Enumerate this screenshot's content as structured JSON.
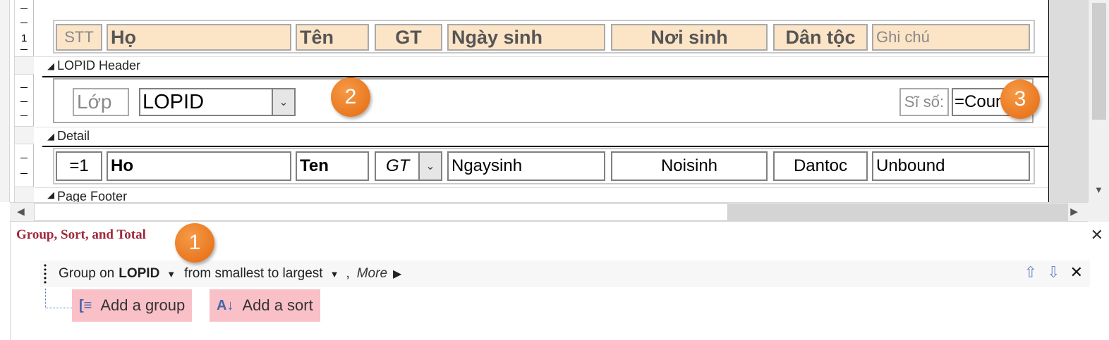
{
  "ruler": {
    "number": "1"
  },
  "page_header": {
    "labels": [
      "STT",
      "Họ",
      "Tên",
      "GT",
      "Ngày sinh",
      "Nơi sinh",
      "Dân tộc",
      "Ghi  chú"
    ]
  },
  "lopid_header": {
    "section_label": "LOPID Header",
    "label_lop": "Lớp",
    "combo_value": "LOPID",
    "label_siso": "Sĩ số:",
    "count_value": "=Coun"
  },
  "detail": {
    "section_label": "Detail",
    "fields": [
      "=1",
      "Ho",
      "Ten",
      "GT",
      "Ngaysinh",
      "Noisinh",
      "Dantoc",
      "Unbound"
    ]
  },
  "page_footer": {
    "section_label": "Page Footer"
  },
  "badges": [
    "1",
    "2",
    "3"
  ],
  "group_sort_total": {
    "title": "Group, Sort, and Total",
    "group_on_text": "Group on",
    "group_field": "LOPID",
    "order": "from smallest to largest",
    "comma": ",",
    "more": "More",
    "add_group": "Add a group",
    "add_sort": "Add a sort"
  }
}
